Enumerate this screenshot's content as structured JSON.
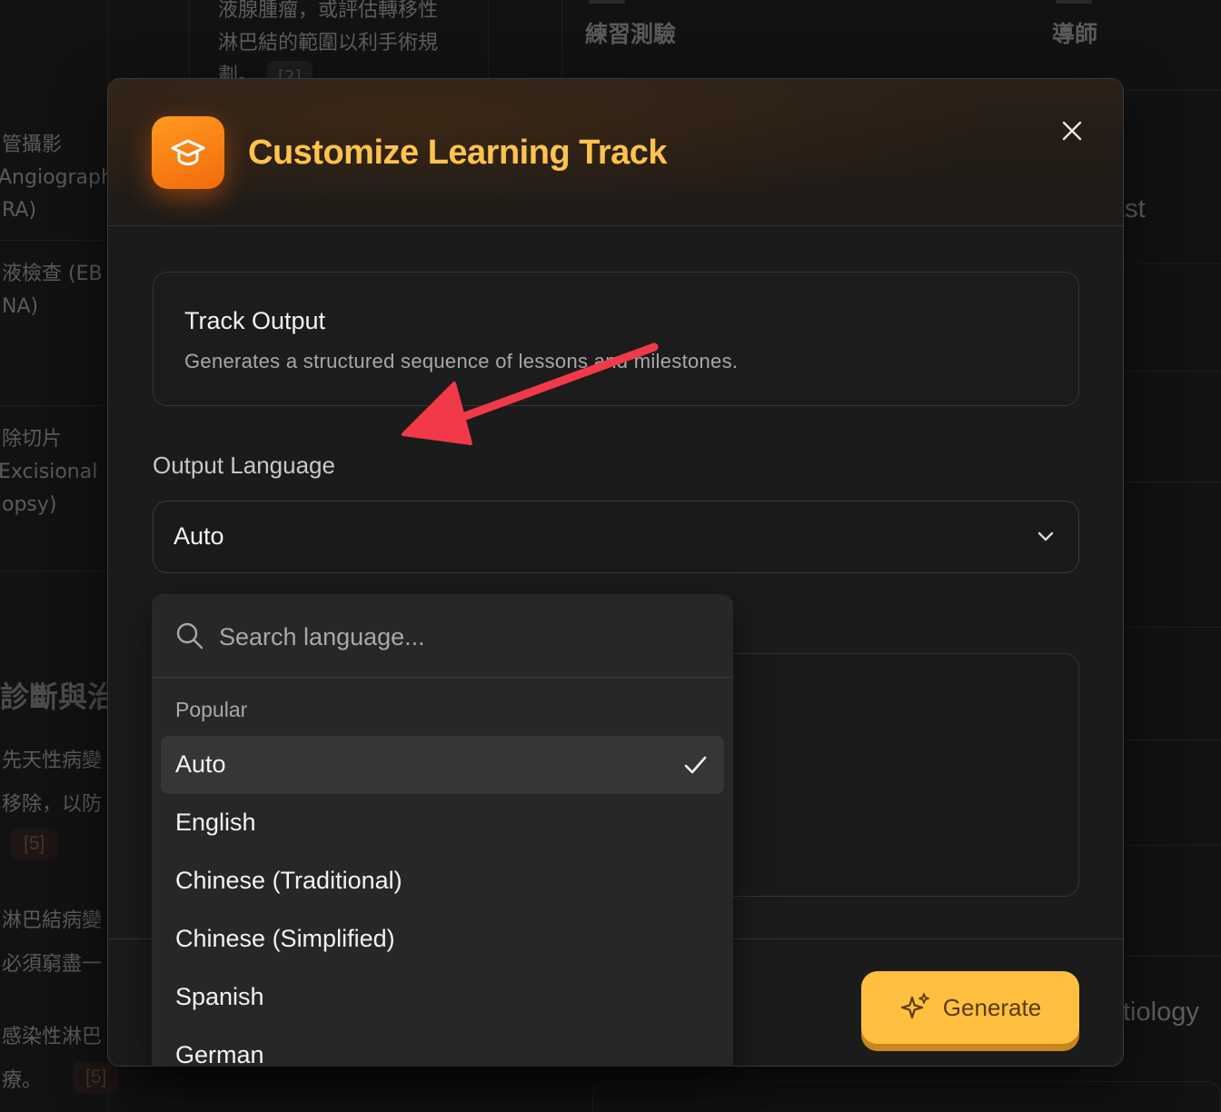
{
  "background": {
    "top_text": [
      "液腺腫瘤，或評估轉移性",
      "淋巴結的範圍以利手術規",
      "劃。"
    ],
    "top_ref": "[2]",
    "tabs": [
      "練習測驗",
      "導師"
    ],
    "left_items": [
      [
        "管攝影",
        "Angiograph",
        "RA)"
      ],
      [
        "液檢查 (EB",
        "NA)"
      ],
      [
        "除切片",
        "Excisional",
        "opsy)"
      ]
    ],
    "left_section_title": "診斷與治",
    "left_section_items": [
      [
        "先天性病變",
        "移除，以防"
      ],
      [
        "淋巴結病變",
        "必須窮盡一"
      ],
      [
        "感染性淋巴",
        "療。"
      ]
    ],
    "left_refs": [
      "[5]",
      "[5]"
    ],
    "right_texts": [
      "ast",
      "tiology"
    ]
  },
  "modal": {
    "title": "Customize Learning Track",
    "header_icon": "graduation-cap-icon",
    "close_icon": "close-icon",
    "track_card": {
      "title": "Track Output",
      "description": "Generates a structured sequence of lessons and milestones."
    },
    "language": {
      "label": "Output Language",
      "selected": "Auto"
    },
    "hint": "",
    "generate_label": "Generate"
  },
  "dropdown": {
    "search_placeholder": "Search language...",
    "group_label": "Popular",
    "items": [
      {
        "label": "Auto",
        "selected": true
      },
      {
        "label": "English",
        "selected": false
      },
      {
        "label": "Chinese (Traditional)",
        "selected": false
      },
      {
        "label": "Chinese (Simplified)",
        "selected": false
      },
      {
        "label": "Spanish",
        "selected": false
      },
      {
        "label": "German",
        "selected": false
      }
    ]
  },
  "colors": {
    "accent": "#ffc34d",
    "button": "#ffbf3f",
    "icon_gradient_start": "#ff9a1f",
    "icon_gradient_end": "#f26a0c",
    "annotation_arrow": "#f2394a"
  }
}
